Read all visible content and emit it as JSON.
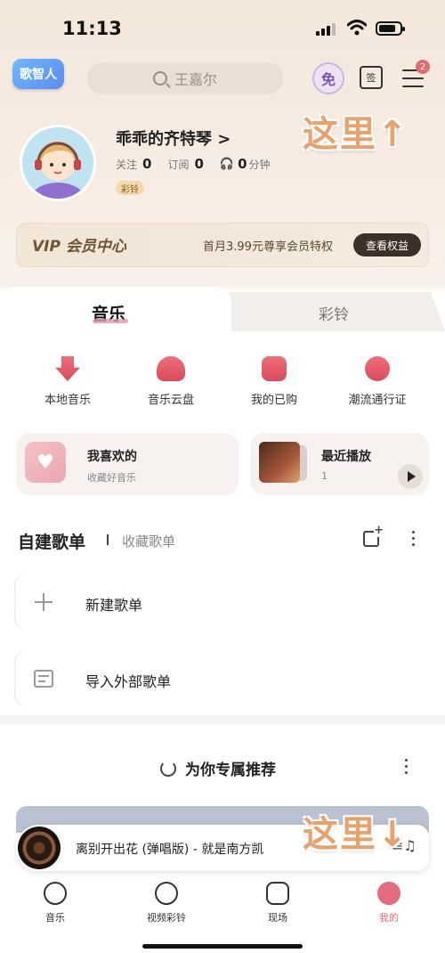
{
  "status_bar": {
    "time": "11:13"
  },
  "header": {
    "logo_text": "歌智人",
    "search_placeholder": "王嘉尔",
    "free_badge": "免",
    "sign_icon_text": "签",
    "menu_badge_count": "2",
    "hint_top": "这里↑",
    "hint_bottom": "这里↓"
  },
  "profile": {
    "name": "乖乖的齐特琴 >",
    "follow_label": "关注",
    "follow_count": "0",
    "subscribe_label": "订阅",
    "subscribe_count": "0",
    "listen_count": "0",
    "listen_unit": "分钟",
    "tag": "彩铃"
  },
  "vip": {
    "title": "VIP 会员中心",
    "promo": "首月3.99元尊享会员特权",
    "button": "查看权益"
  },
  "tabs": [
    "音乐",
    "彩铃"
  ],
  "quick_entries": [
    {
      "label": "本地音乐",
      "icon": "download-arrow-icon"
    },
    {
      "label": "音乐云盘",
      "icon": "cloud-upload-icon"
    },
    {
      "label": "我的已购",
      "icon": "shopping-bag-icon"
    },
    {
      "label": "潮流通行证",
      "icon": "magic-pass-icon"
    }
  ],
  "cards": {
    "liked": {
      "title": "我喜欢的",
      "subtitle": "收藏好音乐"
    },
    "recent": {
      "title": "最近播放",
      "subtitle": "1"
    }
  },
  "playlists": {
    "tab_active": "自建歌单",
    "tab_inactive": "收藏歌单",
    "rows": [
      {
        "label": "新建歌单",
        "icon": "plus-icon"
      },
      {
        "label": "导入外部歌单",
        "icon": "import-list-icon"
      }
    ]
  },
  "recommend": {
    "title": "为你专属推荐"
  },
  "mini_player": {
    "song": "离别开出花 (弹唱版) - 就是南方凯"
  },
  "bottom_nav": [
    {
      "label": "音乐",
      "active": false
    },
    {
      "label": "视频彩铃",
      "active": false
    },
    {
      "label": "现场",
      "active": false
    },
    {
      "label": "我的",
      "active": true
    }
  ],
  "colors": {
    "accent": "#e36b7d",
    "hint": "#e8a36d",
    "vip_button": "#3d3026"
  }
}
